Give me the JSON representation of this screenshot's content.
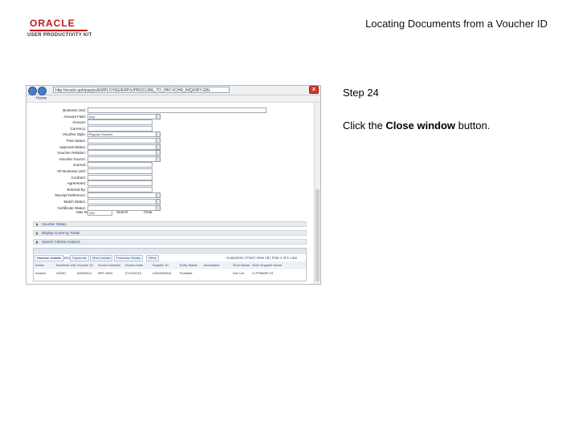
{
  "logo": {
    "brand": "ORACLE",
    "product": "USER PRODUCTIVITY KIT"
  },
  "header": {
    "title": "Locating Documents from a Voucher ID"
  },
  "step": {
    "label": "Step 24",
    "instruction_prefix": "Click the ",
    "instruction_bold": "Close window",
    "instruction_suffix": " button."
  },
  "browser": {
    "url": "http://oracle.upk/psp/ps/EMPLOYEE/ERP/c/PROCURE_TO_PAY.VCHR_INQUIRY.GBL",
    "home_label": "Home",
    "close_glyph": "x"
  },
  "form": {
    "fields": [
      {
        "label": "Business Unit:",
        "value": ""
      },
      {
        "label": "Amount Field:",
        "value": "Any"
      },
      {
        "label": "Amount:",
        "value": ""
      },
      {
        "label": "Currency:",
        "value": ""
      },
      {
        "label": "Voucher Style:",
        "value": "Regular Voucher"
      },
      {
        "label": "Post Status:",
        "value": ""
      },
      {
        "label": "Approval Status:",
        "value": ""
      },
      {
        "label": "Voucher Relation:",
        "value": ""
      },
      {
        "label": "Voucher Source:",
        "value": ""
      },
      {
        "label": "Journal:",
        "value": ""
      },
      {
        "label": "AP Business Unit:",
        "value": ""
      },
      {
        "label": "Contract:",
        "value": ""
      },
      {
        "label": "Agreement:",
        "value": ""
      },
      {
        "label": "Entered By:",
        "value": ""
      },
      {
        "label": "Receipt Reference:",
        "value": ""
      },
      {
        "label": "Match Status:",
        "value": ""
      },
      {
        "label": "Certificate Status:",
        "value": ""
      }
    ],
    "max_rows_label": "Max Rows:",
    "max_rows_value": "100",
    "search_label": "Search",
    "clear_label": "Clear"
  },
  "sections": [
    "Voucher Status",
    "Display Currency Totals",
    "Search Criteria Analysis"
  ],
  "results": {
    "title": "Voucher Inquiry Results",
    "tabs": [
      "Voucher Details",
      "Payments",
      "More Details",
      "Purchase Details",
      "Other"
    ],
    "nav": "Customize | Find | View All | First  1 of 1  Last",
    "columns": [
      "Action",
      "Business Unit",
      "Voucher ID",
      "Invoice Number",
      "Invoice Date",
      "Supplier ID",
      "Entry Status",
      "Incomplete",
      "Short Name",
      "Short Supplier Name"
    ],
    "rows": [
      [
        "Actions",
        "US001",
        "00000004",
        "REF-9904",
        "07/13/2015",
        "USA0000001",
        "Postable",
        "",
        "Doc Uni",
        "O-PSMART-01"
      ]
    ]
  }
}
